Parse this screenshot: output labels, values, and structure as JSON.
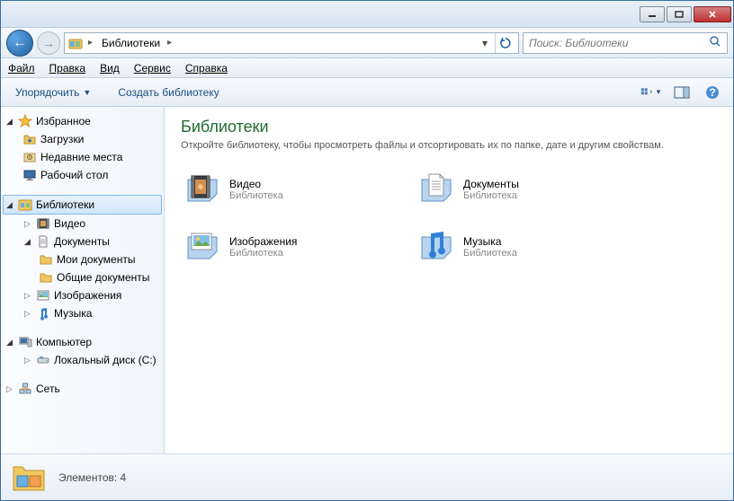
{
  "breadcrumb": {
    "root": "Библиотеки"
  },
  "search": {
    "placeholder": "Поиск: Библиотеки"
  },
  "menu": {
    "file": "Файл",
    "edit": "Правка",
    "view": "Вид",
    "tools": "Сервис",
    "help": "Справка"
  },
  "toolbar": {
    "organize": "Упорядочить",
    "newlib": "Создать библиотеку"
  },
  "sidebar": {
    "favorites": {
      "label": "Избранное",
      "items": [
        "Загрузки",
        "Недавние места",
        "Рабочий стол"
      ]
    },
    "libraries": {
      "label": "Библиотеки",
      "items": [
        "Видео",
        "Документы",
        "Изображения",
        "Музыка"
      ],
      "docs_children": [
        "Мои документы",
        "Общие документы"
      ]
    },
    "computer": {
      "label": "Компьютер",
      "items": [
        "Локальный диск (C:)"
      ]
    },
    "network": {
      "label": "Сеть"
    }
  },
  "content": {
    "title": "Библиотеки",
    "subtitle": "Откройте библиотеку, чтобы просмотреть файлы и отсортировать их по папке, дате и другим свойствам.",
    "items": [
      {
        "name": "Видео",
        "type": "Библиотека"
      },
      {
        "name": "Документы",
        "type": "Библиотека"
      },
      {
        "name": "Изображения",
        "type": "Библиотека"
      },
      {
        "name": "Музыка",
        "type": "Библиотека"
      }
    ]
  },
  "status": {
    "text": "Элементов: 4"
  }
}
